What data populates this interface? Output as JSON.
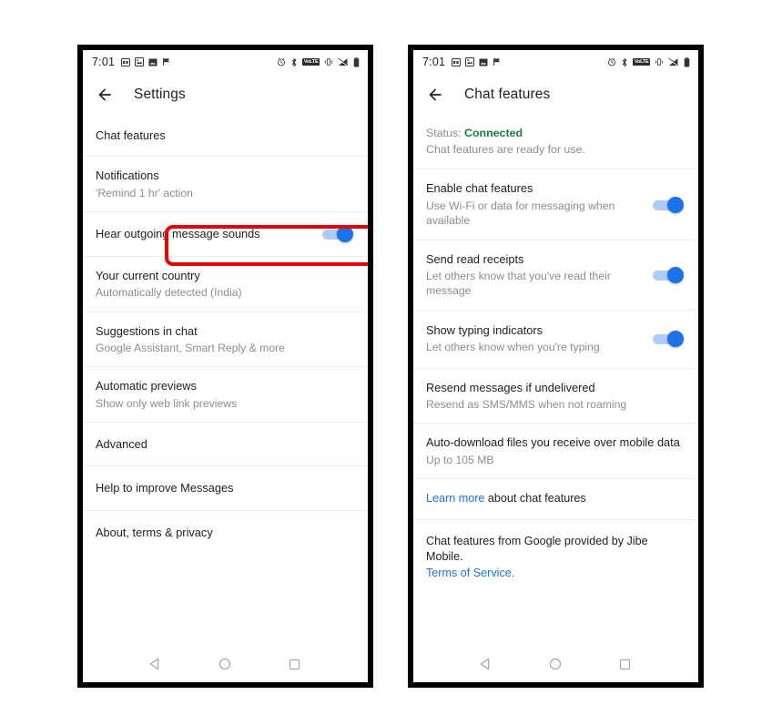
{
  "statusbar": {
    "time": "7:01",
    "left_icons": [
      "sim-card-icon",
      "photo-message-icon",
      "image-icon",
      "flag-icon"
    ],
    "right_icons": [
      "alarm-icon",
      "bluetooth-icon",
      "volte-icon",
      "vibrate-icon",
      "signal-off-icon",
      "battery-icon"
    ],
    "volte_label": "VoLTE"
  },
  "navbar": {
    "back_label": "back-nav",
    "home_label": "home-nav",
    "recents_label": "recents-nav"
  },
  "left_phone": {
    "appbar": {
      "title": "Settings",
      "back_icon": "back-arrow-icon"
    },
    "items": [
      {
        "title": "Chat features",
        "sub": "",
        "toggle": null
      },
      {
        "title": "Notifications",
        "sub": "'Remind 1 hr' action",
        "toggle": null
      },
      {
        "title": "Hear outgoing message sounds",
        "sub": "",
        "toggle": "on"
      },
      {
        "title": "Your current country",
        "sub": "Automatically detected (India)",
        "toggle": null
      },
      {
        "title": "Suggestions in chat",
        "sub": "Google Assistant, Smart Reply & more",
        "toggle": null
      },
      {
        "title": "Automatic previews",
        "sub": "Show only web link previews",
        "toggle": null
      },
      {
        "title": "Advanced",
        "sub": "",
        "toggle": null
      },
      {
        "title": "Help to improve Messages",
        "sub": "",
        "toggle": null
      },
      {
        "title": "About, terms & privacy",
        "sub": "",
        "toggle": null
      }
    ]
  },
  "right_phone": {
    "appbar": {
      "title": "Chat features",
      "back_icon": "back-arrow-icon"
    },
    "status": {
      "label": "Status: ",
      "value": "Connected",
      "sub": "Chat features are ready for use."
    },
    "items": [
      {
        "title": "Enable chat features",
        "sub": "Use Wi-Fi or data for messaging when available",
        "toggle": "on"
      },
      {
        "title": "Send read receipts",
        "sub": "Let others know that you've read their message",
        "toggle": "on"
      },
      {
        "title": "Show typing indicators",
        "sub": "Let others know when you're typing",
        "toggle": "on"
      },
      {
        "title": "Resend messages if undelivered",
        "sub": "Resend as SMS/MMS when not roaming",
        "toggle": null
      },
      {
        "title": "Auto-download files you receive over mobile data",
        "sub": "Up to 105 MB",
        "toggle": null
      }
    ],
    "learn_more": {
      "link": "Learn more",
      "rest": " about chat features"
    },
    "provider": {
      "text": "Chat features from Google provided by Jibe Mobile.",
      "link": "Terms of Service."
    }
  },
  "annotations": {
    "highlight_color": "#ee0000",
    "left_target": "Chat features",
    "right_target": "chat-features-toggles-group"
  },
  "colors": {
    "accent": "#1a73e8",
    "toggle_track": "#aecbfa",
    "connected_green": "#188038",
    "primary_text": "#202124",
    "secondary_text": "#8a8d91"
  }
}
